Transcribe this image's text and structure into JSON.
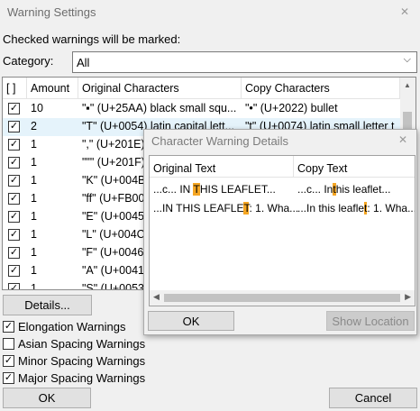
{
  "window": {
    "title": "Warning Settings",
    "close_glyph": "✕",
    "checked_label": "Checked warnings will be marked:",
    "category_label": "Category:",
    "category_value": "All"
  },
  "table": {
    "headers": [
      "[ ]",
      "Amount",
      "Original Characters",
      "Copy Characters"
    ],
    "rows": [
      {
        "checked": true,
        "amount": "10",
        "original": "\"▪\" (U+25AA) black small squ...",
        "copy": "\"•\" (U+2022) bullet"
      },
      {
        "checked": true,
        "amount": "2",
        "original": "\"T\" (U+0054) latin capital lett...",
        "copy": "\"t\" (U+0074) latin small letter t"
      },
      {
        "checked": true,
        "amount": "1",
        "original": "\",\" (U+201E)",
        "copy": ""
      },
      {
        "checked": true,
        "amount": "1",
        "original": "\"\"\" (U+201F)",
        "copy": ""
      },
      {
        "checked": true,
        "amount": "1",
        "original": "\"K\" (U+004B)",
        "copy": ""
      },
      {
        "checked": true,
        "amount": "1",
        "original": "\"ff\" (U+FB00)",
        "copy": ""
      },
      {
        "checked": true,
        "amount": "1",
        "original": "\"E\" (U+0045)",
        "copy": ""
      },
      {
        "checked": true,
        "amount": "1",
        "original": "\"L\" (U+004C)",
        "copy": ""
      },
      {
        "checked": true,
        "amount": "1",
        "original": "\"F\" (U+0046)",
        "copy": ""
      },
      {
        "checked": true,
        "amount": "1",
        "original": "\"A\" (U+0041)",
        "copy": ""
      },
      {
        "checked": true,
        "amount": "1",
        "original": "\"S\" (U+0053)",
        "copy": ""
      }
    ]
  },
  "buttons": {
    "details": "Details...",
    "ok": "OK",
    "cancel": "Cancel"
  },
  "options": [
    {
      "label": "Elongation Warnings",
      "checked": true
    },
    {
      "label": "Asian Spacing Warnings",
      "checked": false
    },
    {
      "label": "Minor Spacing Warnings",
      "checked": true
    },
    {
      "label": "Major Spacing Warnings",
      "checked": true
    }
  ],
  "dialog": {
    "title": "Character Warning Details",
    "headers": [
      "Original Text",
      "Copy Text"
    ],
    "rows": [
      {
        "orig_pre": "...c... IN ",
        "orig_hl": "T",
        "orig_post": "HIS  LEAFLET...",
        "copy_pre": "...c... In",
        "copy_hl": "t",
        "copy_post": "his  leaflet..."
      },
      {
        "orig_pre": "...IN THIS LEAFLE",
        "orig_hl": "T",
        "orig_post": ": 1. Wha...",
        "copy_pre": "...In this leafle",
        "copy_hl": "t",
        "copy_post": ": 1. Wha..."
      }
    ],
    "ok": "OK",
    "show_location": "Show Location",
    "scroll_left_glyph": "◀",
    "scroll_right_glyph": "▶"
  },
  "glyphs": {
    "checkmark": "✓",
    "chevron": "⌵",
    "scroll_up": "▲"
  },
  "colors": {
    "highlight": "#f5a623",
    "selection": "#e5f3fb"
  }
}
